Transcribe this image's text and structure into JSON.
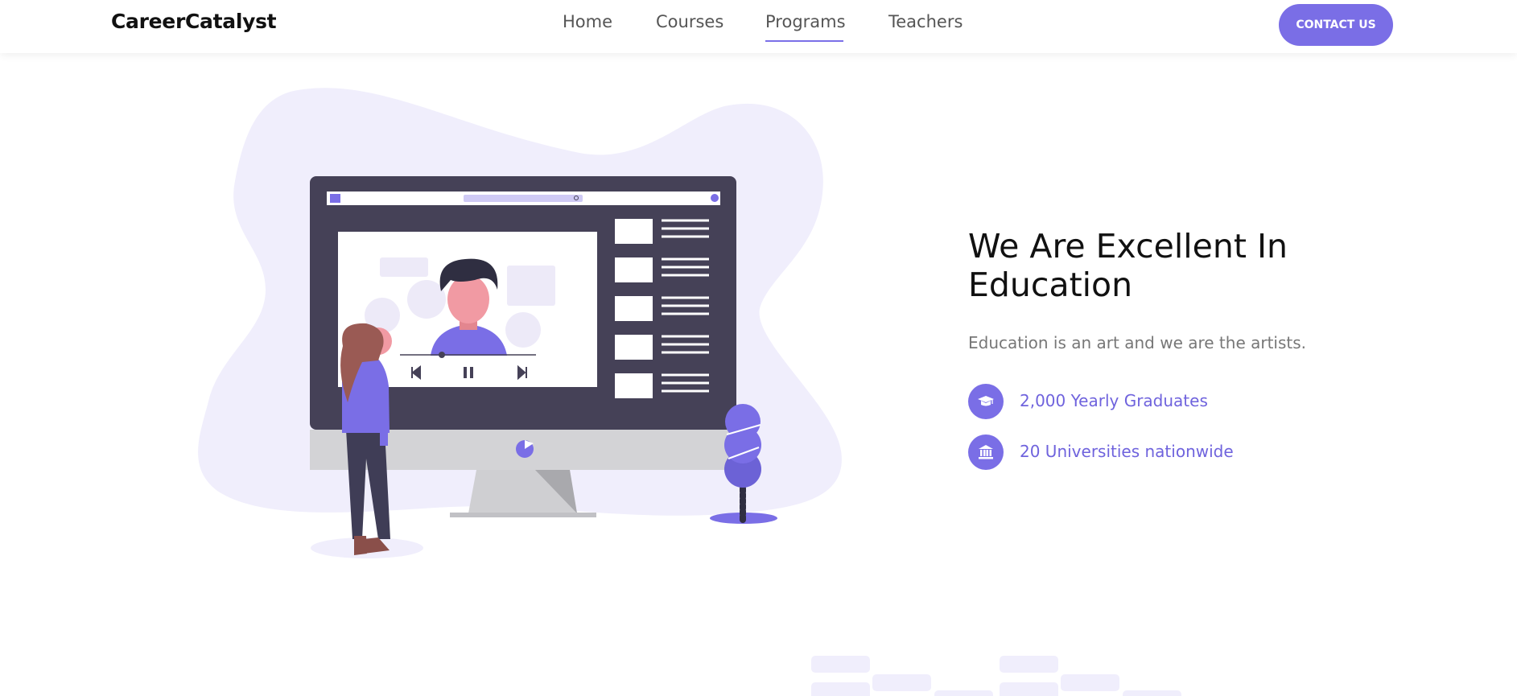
{
  "brand": {
    "name": "CareerCatalyst"
  },
  "nav": {
    "items": [
      {
        "label": "Home",
        "active": false
      },
      {
        "label": "Courses",
        "active": false
      },
      {
        "label": "Programs",
        "active": true
      },
      {
        "label": "Teachers",
        "active": false
      }
    ],
    "contact_label": "CONTACT US"
  },
  "hero": {
    "title": "We Are Excellent In Education",
    "subtitle": "Education is an art and we are the artists.",
    "features": [
      {
        "icon": "graduation-cap-icon",
        "text": "2,000 Yearly Graduates"
      },
      {
        "icon": "university-building-icon",
        "text": "20 Universities nationwide"
      }
    ]
  },
  "colors": {
    "accent": "#7a6ee6",
    "blob": "#f0eefc",
    "monitor_frame": "#454157",
    "text_dark": "#111111",
    "text_muted": "#777777"
  }
}
